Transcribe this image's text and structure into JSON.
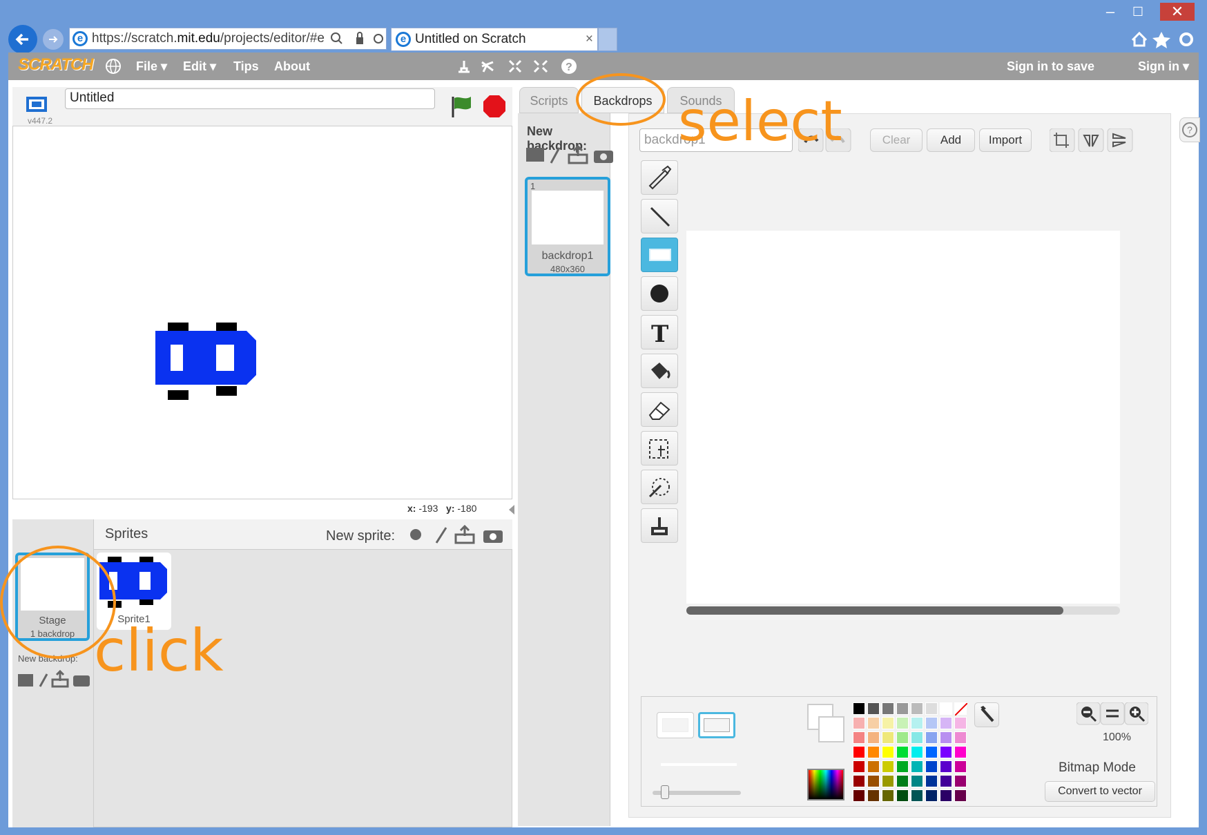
{
  "browser": {
    "url_prefix": "https://scratch.",
    "url_domain": "mit.edu",
    "url_suffix": "/projects/editor/#e",
    "tab_title": "Untitled on Scratch",
    "tab_close": "×",
    "minimize": "–",
    "maximize": "☐",
    "close": "✕"
  },
  "menu": {
    "logo": "SCRATCH",
    "file": "File ▾",
    "edit": "Edit ▾",
    "tips": "Tips",
    "about": "About",
    "sign_in_save": "Sign in to save",
    "sign_in": "Sign in ▾"
  },
  "stage": {
    "project_title": "Untitled",
    "version": "v447.2",
    "x_label": "x:",
    "x_value": "-193",
    "y_label": "y:",
    "y_value": "-180"
  },
  "sprites": {
    "header": "Sprites",
    "new_sprite": "New sprite:",
    "stage_label": "Stage",
    "stage_sub": "1 backdrop",
    "new_backdrop": "New backdrop:",
    "sprite1": "Sprite1"
  },
  "tabs": {
    "scripts": "Scripts",
    "backdrops": "Backdrops",
    "sounds": "Sounds"
  },
  "backdrops": {
    "new_backdrop": "New backdrop:",
    "item_index": "1",
    "item_name": "backdrop1",
    "item_size": "480x360"
  },
  "editor": {
    "name_field": "backdrop1",
    "clear": "Clear",
    "add": "Add",
    "import": "Import",
    "zoom": "100%",
    "mode": "Bitmap Mode",
    "convert": "Convert to vector",
    "help": "?"
  },
  "annotations": {
    "select": "select",
    "click": "click"
  },
  "palette": [
    [
      "#000000",
      "#555555",
      "#777777",
      "#999999",
      "#bbbbbb",
      "#dddddd",
      "#ffffff",
      "none"
    ],
    [
      "#f7b0b0",
      "#f7cfa5",
      "#f6f2a6",
      "#c8f2b6",
      "#b5f1f0",
      "#b5c7f6",
      "#d6b5f6",
      "#f5b5e5"
    ],
    [
      "#f48383",
      "#f4b37f",
      "#efe87a",
      "#9fe98a",
      "#85e8e6",
      "#88a4f0",
      "#b88ff0",
      "#ee8ad2"
    ],
    [
      "#ff0000",
      "#ff8800",
      "#ffff00",
      "#00dd33",
      "#00eeee",
      "#0066ff",
      "#7a00ff",
      "#ff00cc"
    ],
    [
      "#cc0000",
      "#cc7000",
      "#cccc00",
      "#00aa22",
      "#00b5b5",
      "#0044cc",
      "#5a00cc",
      "#cc0099"
    ],
    [
      "#990000",
      "#994f00",
      "#999900",
      "#007d18",
      "#008585",
      "#003399",
      "#420099",
      "#990070"
    ],
    [
      "#660000",
      "#663300",
      "#666600",
      "#004d10",
      "#005555",
      "#002266",
      "#2b0066",
      "#66004a"
    ]
  ]
}
